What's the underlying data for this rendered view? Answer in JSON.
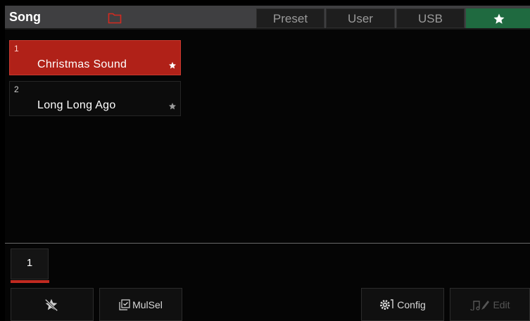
{
  "header": {
    "title": "Song",
    "tabs": [
      {
        "label": "Preset"
      },
      {
        "label": "User"
      },
      {
        "label": "USB"
      },
      {
        "label": "",
        "icon": "star-icon",
        "active": true
      }
    ]
  },
  "songs": [
    {
      "number": "1",
      "name": "Christmas Sound",
      "selected": true,
      "favorite": true
    },
    {
      "number": "2",
      "name": "Long Long Ago",
      "selected": false,
      "favorite": true
    }
  ],
  "pagination": {
    "current_page": "1"
  },
  "toolbar": {
    "unfavorite_icon": "star-remove-icon",
    "multiselect_label": "MulSel",
    "config_label": "Config",
    "edit_label": "Edit"
  },
  "colors": {
    "selected_item": "#b02118",
    "favorite_tab": "#1f6a40",
    "page_indicator": "#c02a20",
    "header_bg": "#3f3f41"
  }
}
